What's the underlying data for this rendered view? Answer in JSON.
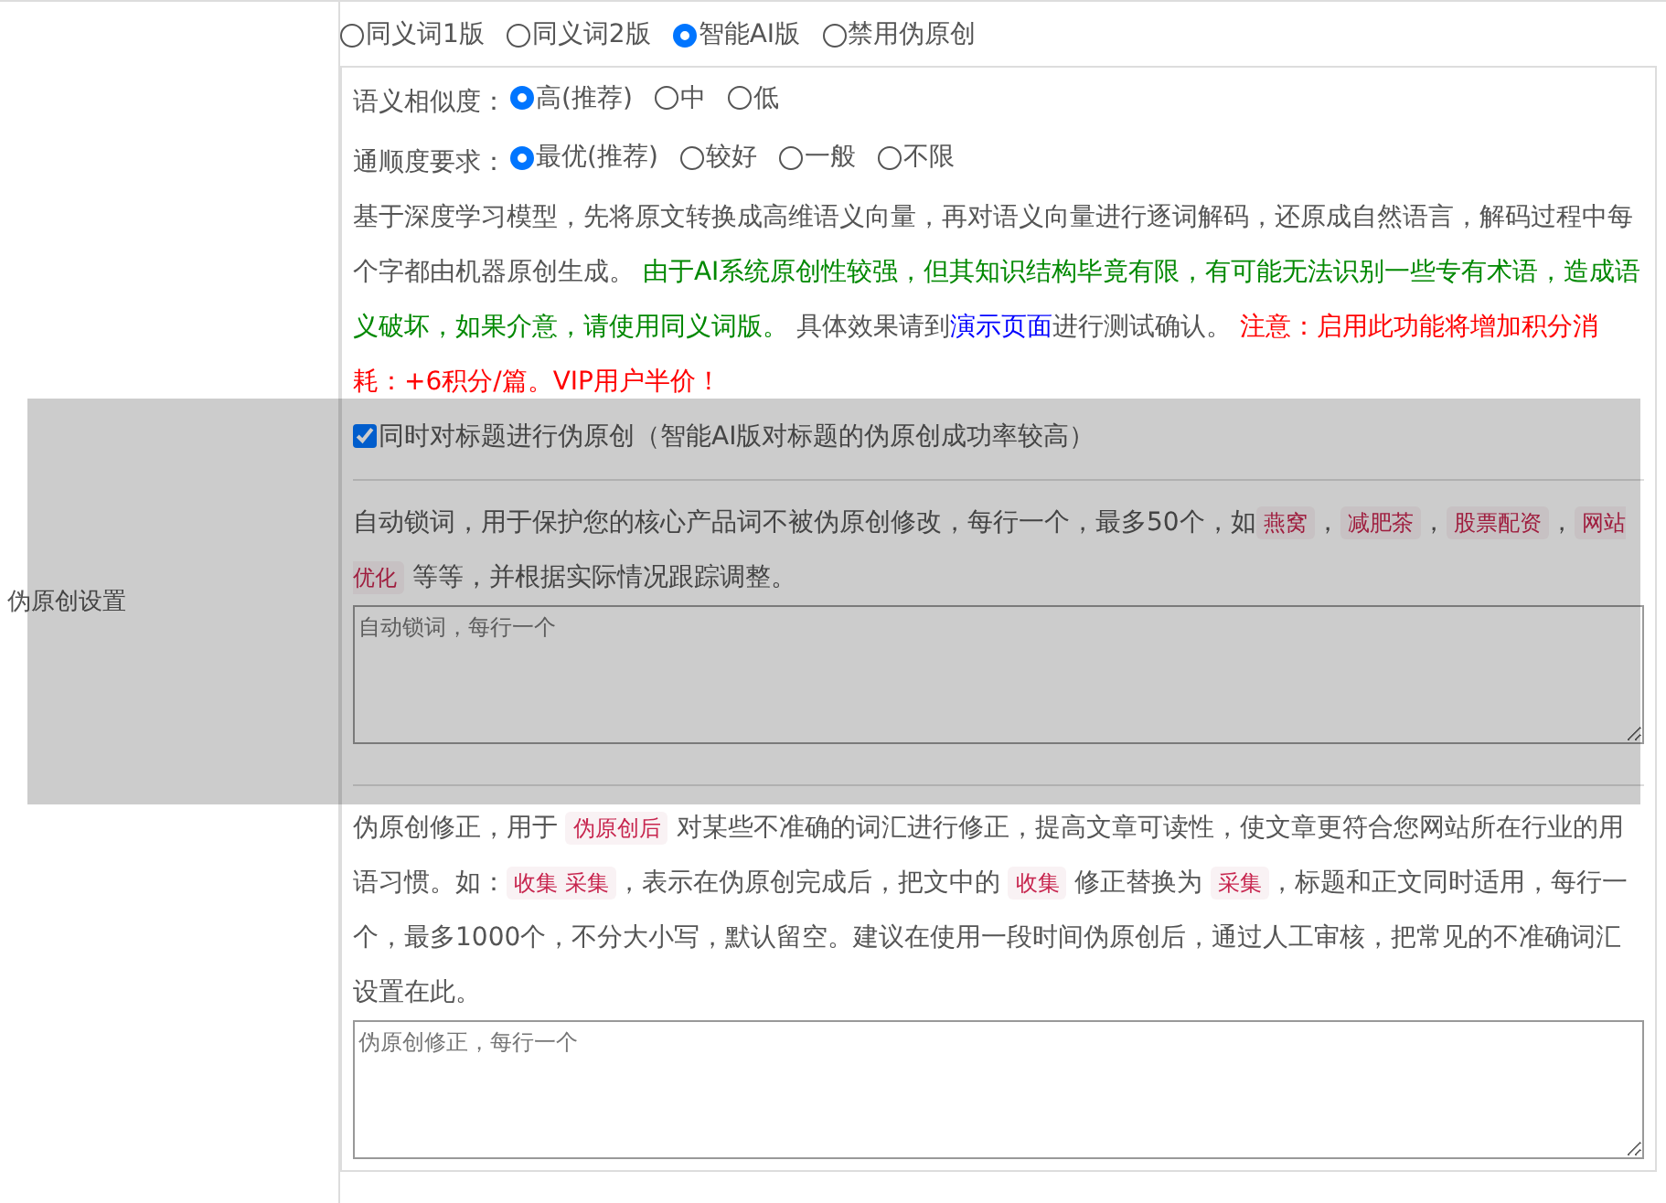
{
  "section_label": "伪原创设置",
  "versions": [
    {
      "label": "同义词1版",
      "selected": false
    },
    {
      "label": "同义词2版",
      "selected": false
    },
    {
      "label": "智能AI版",
      "selected": true
    },
    {
      "label": "禁用伪原创",
      "selected": false
    }
  ],
  "similarity": {
    "label": "语义相似度：",
    "options": [
      {
        "label": "高(推荐)",
        "selected": true
      },
      {
        "label": "中",
        "selected": false
      },
      {
        "label": "低",
        "selected": false
      }
    ]
  },
  "fluency": {
    "label": "通顺度要求：",
    "options": [
      {
        "label": "最优(推荐)",
        "selected": true
      },
      {
        "label": "较好",
        "selected": false
      },
      {
        "label": "一般",
        "selected": false
      },
      {
        "label": "不限",
        "selected": false
      }
    ]
  },
  "ai_description": [
    {
      "kind": "plain",
      "text": "基于深度学习模型，先将原文转换成高维语义向量，再对语义向量进行逐词解码，还原成自然语言，解码过程中每个字都由机器原创生成。 "
    },
    {
      "kind": "green",
      "text": "由于AI系统原创性较强，但其知识结构毕竟有限，有可能无法识别一些专有术语，造成语义破坏，如果介意，请使用同义词版。"
    },
    {
      "kind": "plain",
      "text": " 具体效果请到"
    },
    {
      "kind": "link",
      "text": "演示页面"
    },
    {
      "kind": "plain",
      "text": "进行测试确认。 "
    },
    {
      "kind": "red",
      "text": "注意：启用此功能将增加积分消耗：+6积分/篇。VIP用户半价！"
    }
  ],
  "title_option": {
    "label": "同时对标题进行伪原创（智能AI版对标题的伪原创成功率较高）",
    "checked": true
  },
  "lock_words": {
    "description": [
      {
        "kind": "plain",
        "text": "自动锁词，用于保护您的核心产品词不被伪原创修改，每行一个，最多50个，如"
      },
      {
        "kind": "code",
        "text": "燕窝"
      },
      {
        "kind": "plain",
        "text": "，"
      },
      {
        "kind": "code",
        "text": "减肥茶"
      },
      {
        "kind": "plain",
        "text": "，"
      },
      {
        "kind": "code",
        "text": "股票配资"
      },
      {
        "kind": "plain",
        "text": "，"
      },
      {
        "kind": "code",
        "text": "网站优化"
      },
      {
        "kind": "plain",
        "text": " 等等，并根据实际情况跟踪调整。"
      }
    ],
    "placeholder": "自动锁词，每行一个"
  },
  "corrections": {
    "description": [
      {
        "kind": "plain",
        "text": "伪原创修正，用于 "
      },
      {
        "kind": "code",
        "text": "伪原创后"
      },
      {
        "kind": "plain",
        "text": " 对某些不准确的词汇进行修正，提高文章可读性，使文章更符合您网站所在行业的用语习惯。如："
      },
      {
        "kind": "code",
        "text": "收集 采集"
      },
      {
        "kind": "plain",
        "text": "，表示在伪原创完成后，把文中的 "
      },
      {
        "kind": "code",
        "text": "收集"
      },
      {
        "kind": "plain",
        "text": " 修正替换为 "
      },
      {
        "kind": "code",
        "text": "采集"
      },
      {
        "kind": "plain",
        "text": "，标题和正文同时适用，每行一个，最多1000个，不分大小写，默认留空。建议在使用一段时间伪原创后，通过人工审核，把常见的不准确词汇设置在此。"
      }
    ],
    "placeholder": "伪原创修正，每行一个"
  }
}
